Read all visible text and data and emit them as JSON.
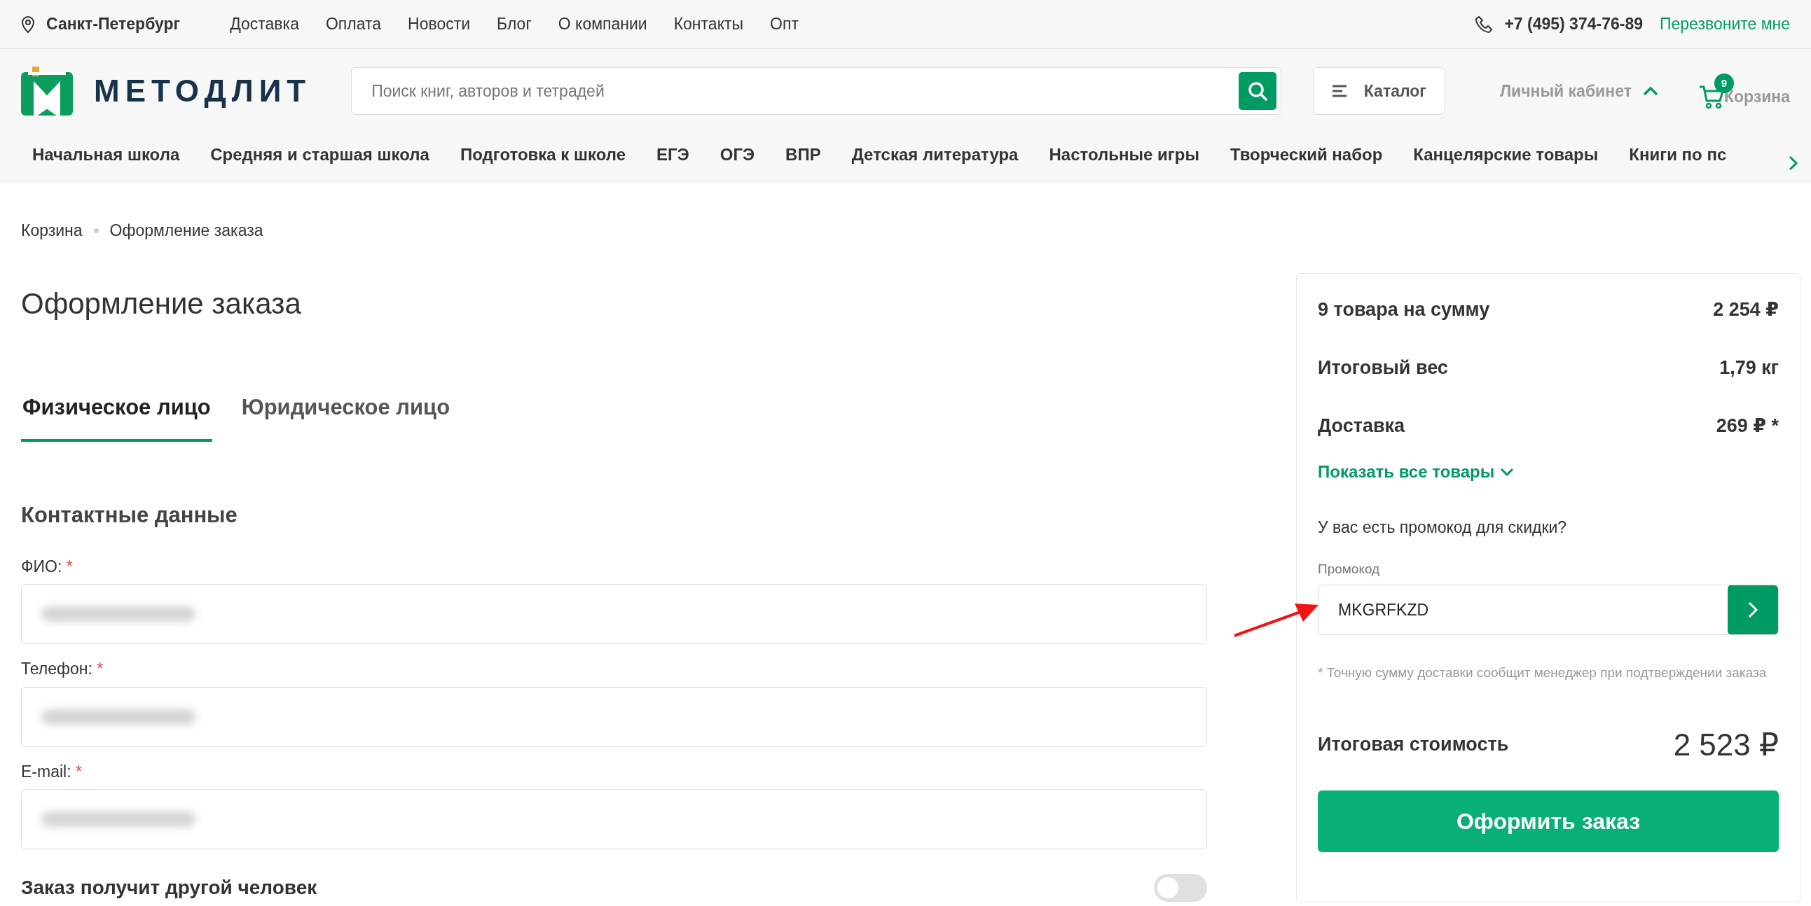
{
  "top_bar": {
    "city": "Санкт-Петербург",
    "links": [
      "Доставка",
      "Оплата",
      "Новости",
      "Блог",
      "О компании",
      "Контакты",
      "Опт"
    ],
    "phone": "+7 (495) 374-76-89",
    "callback": "Перезвоните мне"
  },
  "header": {
    "logo_text": "МЕТОДЛИТ",
    "search": {
      "placeholder": "Поиск книг, авторов и тетрадей"
    },
    "catalog": "Каталог",
    "account": {
      "label": "Личный кабинет",
      "expanded": true
    },
    "cart": {
      "label": "Корзина",
      "count": "9"
    }
  },
  "categories": [
    "Начальная школа",
    "Средняя и старшая школа",
    "Подготовка к школе",
    "ЕГЭ",
    "ОГЭ",
    "ВПР",
    "Детская литература",
    "Настольные игры",
    "Творческий набор",
    "Канцелярские товары",
    "Книги по пс"
  ],
  "breadcrumbs": [
    "Корзина",
    "Оформление заказа"
  ],
  "page_title": "Оформление заказа",
  "tabs": [
    {
      "label": "Физическое лицо",
      "selected": true
    },
    {
      "label": "Юридическое лицо",
      "selected": false
    }
  ],
  "section_title": "Контактные данные",
  "fields": [
    {
      "label": "ФИО:",
      "required_mark": "*",
      "redacted": true
    },
    {
      "label": "Телефон:",
      "required_mark": "*",
      "redacted": true
    },
    {
      "label": "E-mail:",
      "required_mark": "*",
      "redacted": true
    }
  ],
  "toggle": {
    "label": "Заказ получит другой человек",
    "on": false
  },
  "summary": {
    "rows": [
      {
        "label": "9 товара на сумму",
        "value": "2 254 ₽"
      },
      {
        "label": "Итоговый вес",
        "value": "1,79 кг"
      },
      {
        "label": "Доставка",
        "value": "269 ₽ *"
      }
    ],
    "show_all": {
      "label": "Показать все товары",
      "expanded": false
    },
    "promo_question": "У вас есть промокод для скидки?",
    "promo": {
      "label": "Промокод",
      "value": "MKGRFKZD"
    },
    "footnote": "* Точную сумму доставки сообщит менеджер при подтверждении заказа",
    "total": {
      "label": "Итоговая стоимость",
      "value": "2 523 ₽"
    },
    "submit": "Оформить заказ"
  },
  "overlay": {
    "kind": "arrow"
  }
}
